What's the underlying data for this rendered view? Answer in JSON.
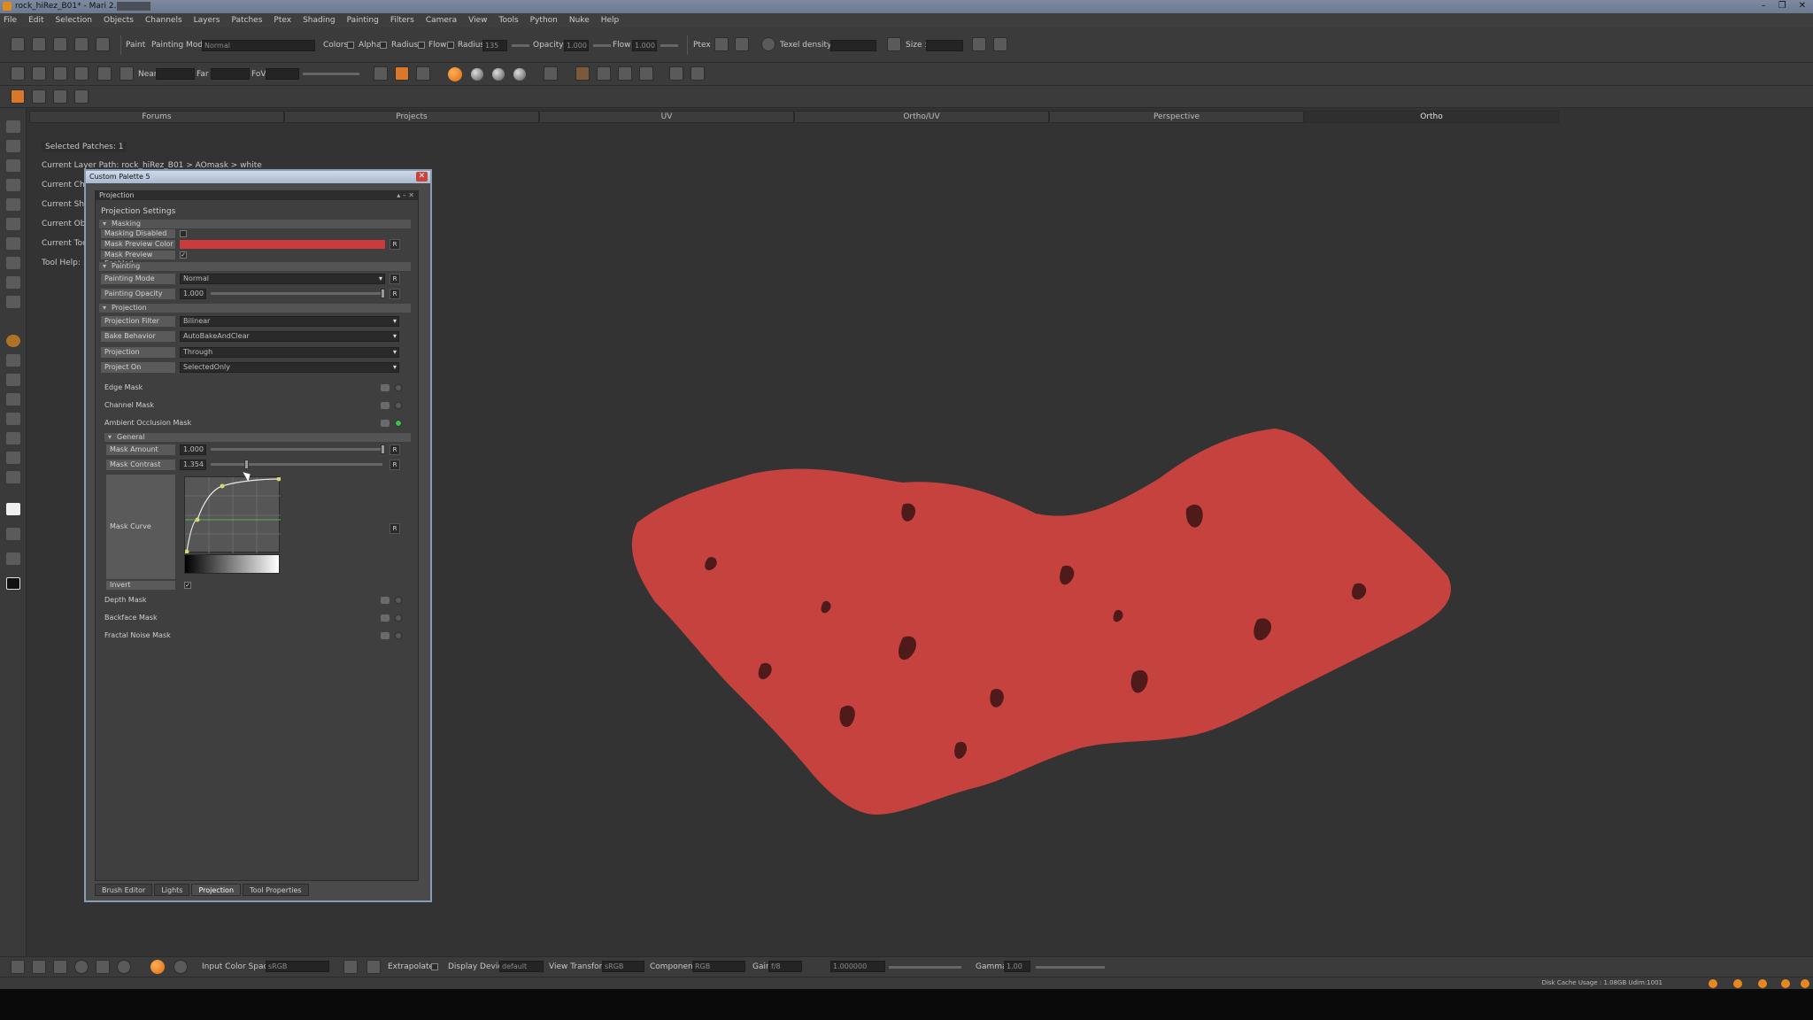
{
  "window": {
    "title": "rock_hiRez_B01* - Mari 2.6v2",
    "controls": [
      "–",
      "❐",
      "✕"
    ]
  },
  "menu": [
    "File",
    "Edit",
    "Selection",
    "Objects",
    "Channels",
    "Layers",
    "Patches",
    "Ptex",
    "Shading",
    "Painting",
    "Filters",
    "Camera",
    "View",
    "Tools",
    "Python",
    "Nuke",
    "Help"
  ],
  "toolbar1": {
    "paint_label": "Paint",
    "painting_mode_label": "Painting Mode",
    "painting_mode_value": "Normal",
    "colors_label": "Colors",
    "alpha_label": "Alpha",
    "radius_label": "Radius",
    "flow_label": "Flow",
    "radius2_label": "Radius",
    "radius_value": "135",
    "opacity_label": "Opacity",
    "opacity_value": "1.000",
    "flow2_label": "Flow",
    "flow_value": "1.000",
    "ptex_label": "Ptex",
    "texel_density_label": "Texel density :",
    "size_label": "Size :"
  },
  "toolbar2": {
    "near_label": "Near",
    "far_label": "Far",
    "fov_label": "FoV"
  },
  "viewtabs": [
    "Forums",
    "Projects",
    "UV",
    "Ortho/UV",
    "Perspective",
    "Ortho"
  ],
  "info": {
    "selected_patches": "Selected Patches: 1",
    "current_layer_path": "Current Layer Path: rock_hiRez_B01 > AOmask > white",
    "current_channel": "Current Ch",
    "current_shader": "Current Sh",
    "current_object": "Current Ob",
    "current_tool": "Current Too",
    "tool_help": "Tool Help:"
  },
  "palette": {
    "title": "Custom Palette 5",
    "subheader": "Projection",
    "section_title": "Projection Settings",
    "masking": {
      "group": "Masking",
      "masking_disabled": "Masking Disabled",
      "mask_preview_color": "Mask Preview Color",
      "mask_preview_color_hex": "#cc3b3b",
      "mask_preview_enabled": "Mask Preview Enabled"
    },
    "painting": {
      "group": "Painting",
      "painting_mode_label": "Painting Mode",
      "painting_mode_value": "Normal",
      "painting_opacity_label": "Painting Opacity",
      "painting_opacity_value": "1.000"
    },
    "projection": {
      "group": "Projection",
      "filter_label": "Projection Filter",
      "filter_value": "Bilinear",
      "bake_label": "Bake Behavior",
      "bake_value": "AutoBakeAndClear",
      "projection_label": "Projection",
      "projection_value": "Through",
      "project_on_label": "Project On",
      "project_on_value": "SelectedOnly"
    },
    "masks": {
      "edge_mask": "Edge Mask",
      "channel_mask": "Channel Mask",
      "ao_mask": "Ambient Occlusion Mask",
      "depth_mask": "Depth Mask",
      "backface_mask": "Backface Mask",
      "fractal_noise_mask": "Fractal Noise Mask"
    },
    "general": {
      "group": "General",
      "mask_amount_label": "Mask Amount",
      "mask_amount_value": "1.000",
      "mask_contrast_label": "Mask Contrast",
      "mask_contrast_value": "1.354",
      "mask_curve_label": "Mask Curve",
      "invert_label": "Invert"
    },
    "r_label": "R",
    "check_mark": "✓",
    "tabs": [
      "Brush Editor",
      "Lights",
      "Projection",
      "Tool Properties"
    ],
    "active_tab": "Projection"
  },
  "bottombar": {
    "input_color_space_label": "Input Color Space",
    "input_color_space_value": "sRGB",
    "extrapolate_label": "Extrapolate",
    "display_device_label": "Display Device",
    "display_device_value": "default",
    "view_transform_label": "View Transform",
    "view_transform_value": "sRGB",
    "component_label": "Component",
    "component_value": "RGB",
    "gain_label": "Gain",
    "gain_value": "f/8",
    "gain_number": "1.000000",
    "gamma_label": "Gamma",
    "gamma_value": "1.00"
  },
  "statusbar": {
    "disk_cache": "Disk Cache Usage : 1.08GB  Udim:1001"
  },
  "colors": {
    "rock": "#c6423f",
    "accent_orange": "#e8871e"
  }
}
